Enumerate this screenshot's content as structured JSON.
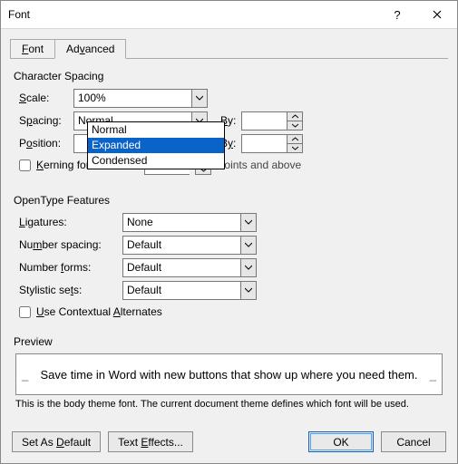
{
  "window": {
    "title": "Font"
  },
  "tabs": {
    "font": "Font",
    "advanced": "Advanced"
  },
  "character_spacing": {
    "group": "Character Spacing",
    "scale": {
      "label": "Scale:",
      "value": "100%"
    },
    "spacing": {
      "label": "Spacing:",
      "value": "Normal",
      "by_label": "By:",
      "by_value": ""
    },
    "position": {
      "label": "Position:",
      "value": "",
      "by_label": "By:",
      "by_value": ""
    },
    "dropdown": {
      "options": [
        "Normal",
        "Expanded",
        "Condensed"
      ],
      "selected": "Expanded"
    },
    "kerning": {
      "label": "Kerning for fonts:",
      "suffix": "Points and above",
      "value": ""
    }
  },
  "opentype": {
    "group": "OpenType Features",
    "ligatures": {
      "label": "Ligatures:",
      "value": "None"
    },
    "num_spacing": {
      "label": "Number spacing:",
      "value": "Default"
    },
    "num_forms": {
      "label": "Number forms:",
      "value": "Default"
    },
    "stylistic": {
      "label": "Stylistic sets:",
      "value": "Default"
    },
    "contextual": {
      "label": "Use Contextual Alternates"
    }
  },
  "preview": {
    "label": "Preview",
    "text": "Save time in Word with new buttons that show up where you need them.",
    "note": "This is the body theme font. The current document theme defines which font will be used."
  },
  "buttons": {
    "set_default": "Set As Default",
    "text_effects": "Text Effects...",
    "ok": "OK",
    "cancel": "Cancel"
  }
}
